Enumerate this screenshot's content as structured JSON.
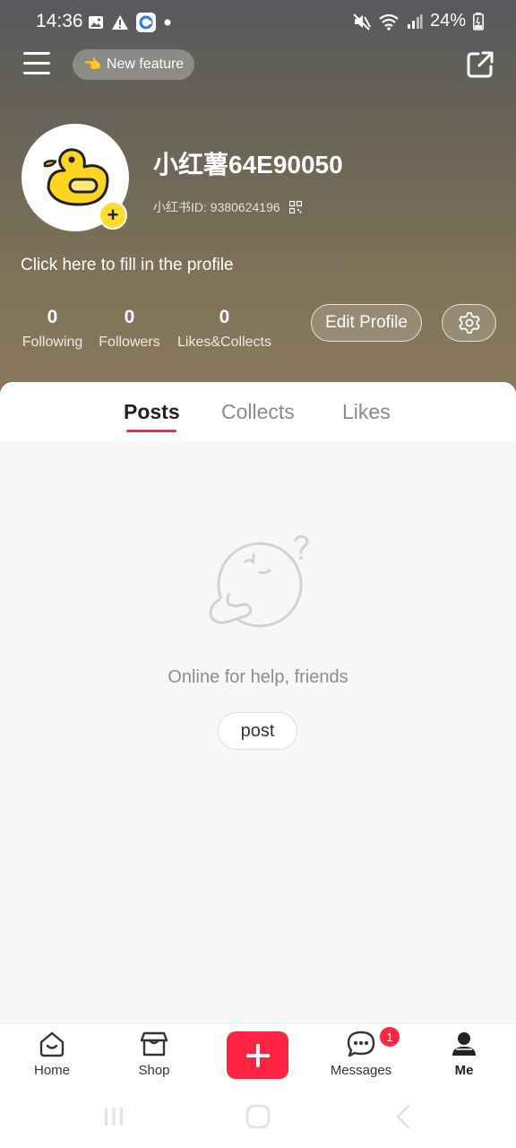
{
  "status_bar": {
    "time": "14:36",
    "battery": "24%"
  },
  "top_bar": {
    "new_feature_label": "New feature",
    "new_feature_emoji": "👈"
  },
  "profile": {
    "name": "小红薯64E90050",
    "id_text": "小红书ID: 9380624196",
    "bio_prompt": "Click here to fill in the profile",
    "stats": [
      {
        "num": "0",
        "label": "Following"
      },
      {
        "num": "0",
        "label": "Followers"
      },
      {
        "num": "0",
        "label": "Likes&Collects"
      }
    ],
    "edit_label": "Edit Profile",
    "avatar_add": "+"
  },
  "tabs": [
    {
      "label": "Posts",
      "active": true
    },
    {
      "label": "Collects",
      "active": false
    },
    {
      "label": "Likes",
      "active": false
    }
  ],
  "empty_state": {
    "text": "Online for help, friends",
    "button": "post"
  },
  "bottom_nav": [
    {
      "label": "Home",
      "icon": "home-icon"
    },
    {
      "label": "Shop",
      "icon": "shop-icon"
    },
    {
      "label": "",
      "icon": "plus-icon"
    },
    {
      "label": "Messages",
      "icon": "chat-icon",
      "badge": "1"
    },
    {
      "label": "Me",
      "icon": "person-icon"
    }
  ],
  "colors": {
    "accent": "#ff2442",
    "avatar_badge": "#ffdc2e"
  }
}
